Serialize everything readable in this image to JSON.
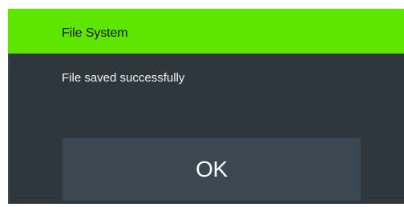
{
  "dialog": {
    "title": "File System",
    "message": "File saved successfully",
    "ok_label": "OK"
  },
  "colors": {
    "titlebar": "#5fe600",
    "body": "#2e373e",
    "button": "#3b4751"
  }
}
